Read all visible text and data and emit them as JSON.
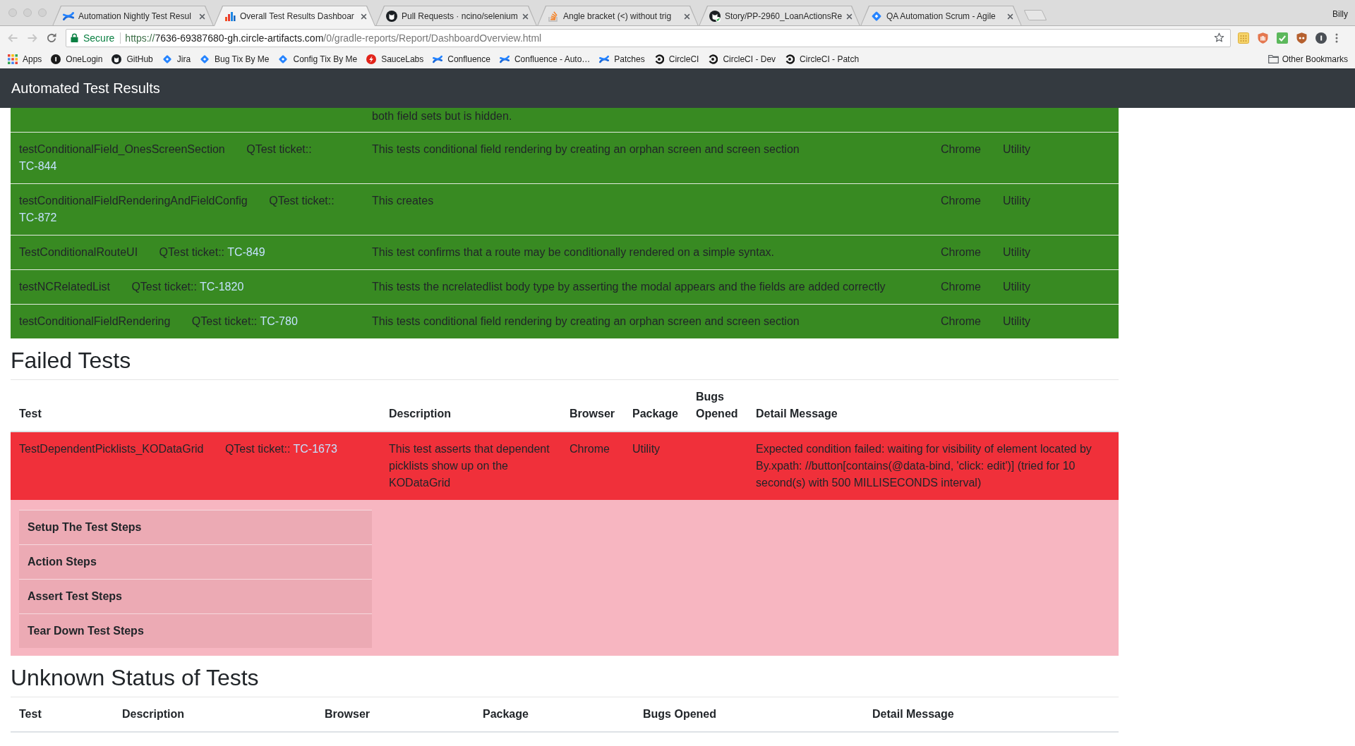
{
  "browser": {
    "tabs": [
      {
        "title": "Automation Nightly Test Resul",
        "selected": false
      },
      {
        "title": "Overall Test Results Dashboar",
        "selected": true
      },
      {
        "title": "Pull Requests · ncino/selenium",
        "selected": false
      },
      {
        "title": "Angle bracket (<) without trig",
        "selected": false
      },
      {
        "title": "Story/PP-2960_LoanActionsRe",
        "selected": false
      },
      {
        "title": "QA Automation Scrum - Agile",
        "selected": false
      }
    ],
    "profile_name": "Billy",
    "address_bar": {
      "security_label": "Secure",
      "url": {
        "scheme": "https://",
        "host": "7636-69387680-gh.circle-artifacts.com",
        "path": "/0/gradle-reports/Report/DashboardOverview.html"
      }
    },
    "bookmarks": [
      "Apps",
      "OneLogin",
      "GitHub",
      "Jira",
      "Bug Tix By Me",
      "Config Tix By Me",
      "SauceLabs",
      "Confluence",
      "Confluence - Auto…",
      "Patches",
      "CircleCI",
      "CircleCI - Dev",
      "CircleCI - Patch"
    ],
    "other_bookmarks": "Other Bookmarks"
  },
  "navbar": {
    "title": "Automated Test Results"
  },
  "passed_tests": {
    "rows": [
      {
        "description": "both field sets but is hidden."
      },
      {
        "test": "testConditionalField_OnesScreenSection",
        "ticket_label": "QTest ticket::",
        "ticket": "TC-844",
        "description": "This tests conditional field rendering by creating an orphan screen and screen section",
        "browser": "Chrome",
        "package": "Utility"
      },
      {
        "test": "testConditionalFieldRenderingAndFieldConfig",
        "ticket_label": "QTest ticket::",
        "ticket": "TC-872",
        "description": "This creates",
        "browser": "Chrome",
        "package": "Utility"
      },
      {
        "test": "TestConditionalRouteUI",
        "ticket_label": "QTest ticket::",
        "ticket": "TC-849",
        "description": "This test confirms that a route may be conditionally rendered on a simple syntax.",
        "browser": "Chrome",
        "package": "Utility"
      },
      {
        "test": "testNCRelatedList",
        "ticket_label": "QTest ticket::",
        "ticket": "TC-1820",
        "description": "This tests the ncrelatedlist body type by asserting the modal appears and the fields are added correctly",
        "browser": "Chrome",
        "package": "Utility"
      },
      {
        "test": "testConditionalFieldRendering",
        "ticket_label": "QTest ticket::",
        "ticket": "TC-780",
        "description": "This tests conditional field rendering by creating an orphan screen and screen section",
        "browser": "Chrome",
        "package": "Utility"
      }
    ]
  },
  "failed_tests": {
    "title": "Failed Tests",
    "columns": [
      "Test",
      "Description",
      "Browser",
      "Package",
      "Bugs Opened",
      "Detail Message"
    ],
    "rows": [
      {
        "test": "TestDependentPicklists_KODataGrid",
        "ticket_label": "QTest ticket::",
        "ticket": "TC-1673",
        "description": "This test asserts that dependent picklists show up on the KODataGrid",
        "browser": "Chrome",
        "package": "Utility",
        "detail_message": "Expected condition failed: waiting for visibility of element located by By.xpath: //button[contains(@data-bind, 'click: edit')] (tried for 10 second(s) with 500 MILLISECONDS interval)",
        "steps": [
          "Setup The Test Steps",
          "Action Steps",
          "Assert Test Steps",
          "Tear Down Test Steps"
        ]
      }
    ]
  },
  "unknown_tests": {
    "title": "Unknown Status of Tests",
    "columns": [
      "Test",
      "Description",
      "Browser",
      "Package",
      "Bugs Opened",
      "Detail Message"
    ]
  }
}
